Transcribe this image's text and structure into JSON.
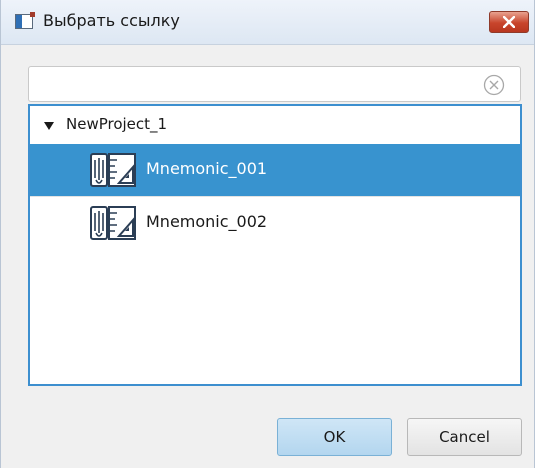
{
  "window": {
    "title": "Выбрать ссылку"
  },
  "search": {
    "value": "",
    "placeholder": ""
  },
  "tree": {
    "root": {
      "label": "NewProject_1",
      "expanded": true
    },
    "items": [
      {
        "label": "Mnemonic_001",
        "icon": "mnemonic-icon",
        "selected": true
      },
      {
        "label": "Mnemonic_002",
        "icon": "mnemonic-icon",
        "selected": false
      }
    ]
  },
  "buttons": {
    "ok_label": "OK",
    "cancel_label": "Cancel"
  },
  "colors": {
    "selection": "#3893cf",
    "tree_border": "#3d8fcf",
    "ok_button": "#c2def2",
    "close_button": "#c8452c"
  }
}
